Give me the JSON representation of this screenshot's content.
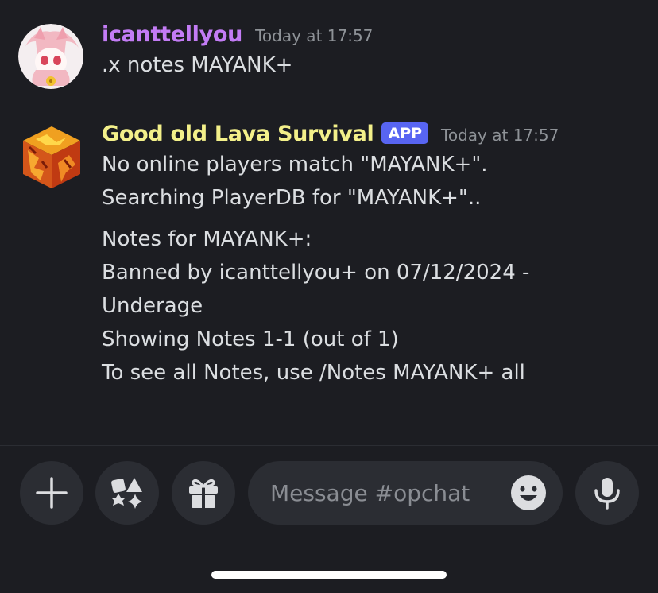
{
  "colors": {
    "background": "#1c1d22",
    "username_user": "#c37cf5",
    "username_bot": "#f3f08a",
    "app_badge": "#5865f2",
    "timestamp": "#8e9297",
    "text": "#dbdee1"
  },
  "messages": [
    {
      "username": "icanttellyou",
      "timestamp": "Today at 17:57",
      "lines": [
        ".x notes MAYANK+"
      ]
    },
    {
      "username": "Good old Lava Survival",
      "badge": "APP",
      "timestamp": "Today at 17:57",
      "lines_block1": [
        "No online players match \"MAYANK+\".",
        "Searching PlayerDB for \"MAYANK+\".."
      ],
      "lines_block2": [
        "Notes for MAYANK+:",
        "Banned by icanttellyou+ on 07/12/2024 -",
        "Underage",
        "Showing Notes 1-1 (out of 1)",
        "To see all Notes, use /Notes MAYANK+ all"
      ]
    }
  ],
  "composer": {
    "placeholder": "Message #opchat",
    "icons": [
      "plus-icon",
      "apps-icon",
      "gift-icon",
      "emoji-icon",
      "microphone-icon"
    ]
  }
}
